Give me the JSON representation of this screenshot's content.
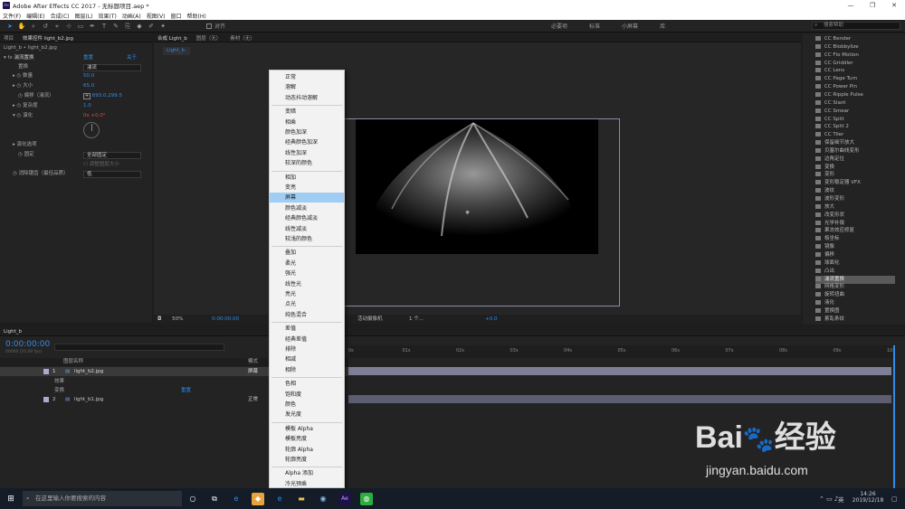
{
  "window": {
    "title": "Adobe After Effects CC 2017 - 无标题项目.aep *",
    "app_icon": "Ae",
    "controls": [
      "—",
      "❐",
      "✕"
    ]
  },
  "menubar": [
    "文件(F)",
    "编辑(E)",
    "合成(C)",
    "图层(L)",
    "效果(T)",
    "动画(A)",
    "视图(V)",
    "窗口",
    "帮助(H)"
  ],
  "toolbar": {
    "align_label": "对齐",
    "workspaces": [
      "必要项",
      "标准",
      "小屏幕",
      "库"
    ],
    "search_placeholder": "搜索帮助"
  },
  "left_panel": {
    "tabs": [
      "项目",
      "效果控件 light_b2.jpg"
    ],
    "crumb": "Light_b • light_b2.jpg",
    "effect_name": "湍流置换",
    "reset": "重置",
    "about": "关于",
    "props": [
      {
        "label": "置换",
        "value": "湍流"
      },
      {
        "label": "数量",
        "value": "50.0"
      },
      {
        "label": "大小",
        "value": "65.0"
      },
      {
        "label": "偏移（湍流）",
        "value": "693.0,299.5"
      },
      {
        "label": "复杂度",
        "value": "1.0"
      },
      {
        "label": "演化",
        "value": "0x +0.0°"
      },
      {
        "label": "演化选项",
        "value": ""
      },
      {
        "label": "固定",
        "value": "全部固定"
      },
      {
        "label": "调整图层大小",
        "value": ""
      },
      {
        "label": "消除锯齿（最佳品质）",
        "value": "低"
      }
    ]
  },
  "comp_panel": {
    "tabs": [
      "合成 Light_b",
      "图层（无）",
      "素材（无）"
    ],
    "comp_chip": "Light_b",
    "zoom": "50%",
    "timecode": "0:00:00:00",
    "camera": "活动摄像机",
    "views": "1 个...",
    "exposure": "+0.0"
  },
  "blend_menu": {
    "groups": [
      [
        "正常",
        "溶解",
        "动态抖动溶解"
      ],
      [
        "变暗",
        "相乘",
        "颜色加深",
        "经典颜色加深",
        "线性加深",
        "较深的颜色"
      ],
      [
        "相加",
        "变亮",
        "屏幕",
        "颜色减淡",
        "经典颜色减淡",
        "线性减淡",
        "较浅的颜色"
      ],
      [
        "叠加",
        "柔光",
        "强光",
        "线性光",
        "亮光",
        "点光",
        "纯色混合"
      ],
      [
        "差值",
        "经典差值",
        "排除",
        "相减",
        "相除"
      ],
      [
        "色相",
        "饱和度",
        "颜色",
        "发光度"
      ],
      [
        "模板 Alpha",
        "模板亮度",
        "轮廓 Alpha",
        "轮廓亮度"
      ],
      [
        "Alpha 添加",
        "冷光预乘"
      ]
    ],
    "selected": "屏幕"
  },
  "effects_list": {
    "items": [
      "CC Bender",
      "CC Blobbylize",
      "CC Flo Motion",
      "CC Griddler",
      "CC Lens",
      "CC Page Turn",
      "CC Power Pin",
      "CC Ripple Pulse",
      "CC Slant",
      "CC Smear",
      "CC Split",
      "CC Split 2",
      "CC Tiler",
      "保留细节放大",
      "贝塞尔曲线变形",
      "边角定位",
      "变换",
      "变形",
      "变形稳定器 VFX",
      "波纹",
      "波形变形",
      "放大",
      "改变形状",
      "光学补偿",
      "果冻效应修复",
      "极坐标",
      "镜像",
      "偏移",
      "球面化",
      "凸出",
      "湍流置换",
      "网格变形",
      "旋转扭曲",
      "液化",
      "置换图",
      "紊乱条纹"
    ],
    "selected": "湍流置换"
  },
  "timeline": {
    "tab": "Light_b",
    "timecode": "0:00:00:00",
    "frame_info": "00000 (25.00 fps)",
    "col_layer": "图层名称",
    "col_mode": "模式",
    "ruler": [
      "0s",
      "01s",
      "02s",
      "03s",
      "04s",
      "05s",
      "06s",
      "07s",
      "08s",
      "09s",
      "10s"
    ],
    "layers": [
      {
        "num": "1",
        "name": "light_b2.jpg",
        "mode": "屏幕"
      },
      {
        "num": "2",
        "name": "light_b1.jpg",
        "mode": "正常"
      }
    ],
    "sub_effects": "效果",
    "sub_transform": "变换",
    "reset": "重置"
  },
  "taskbar": {
    "search": "在这里输入你要搜索的内容",
    "time": "14:26",
    "date": "2019/12/18",
    "ime": "英"
  },
  "watermark": {
    "brand": "Bai",
    "brand2": "经验",
    "url": "jingyan.baidu.com"
  }
}
